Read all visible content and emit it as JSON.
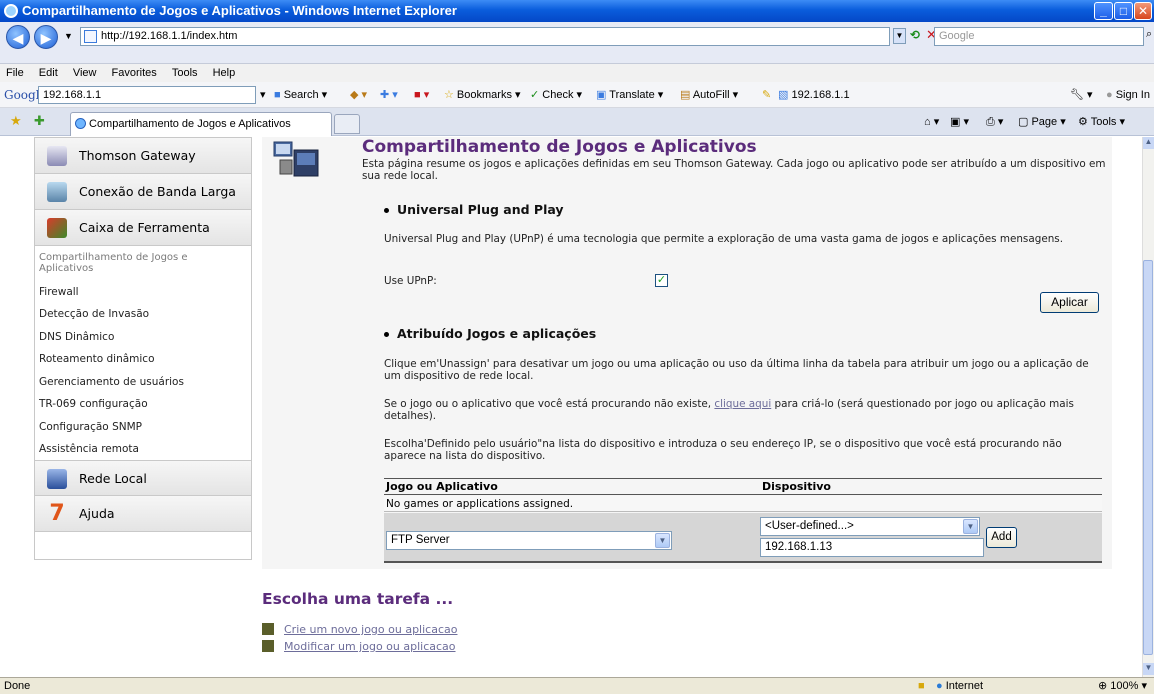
{
  "window": {
    "title": "Compartilhamento de Jogos e Aplicativos - Windows Internet Explorer"
  },
  "address": {
    "url": "http://192.168.1.1/index.htm",
    "search_placeholder": "Google"
  },
  "menu": [
    "File",
    "Edit",
    "View",
    "Favorites",
    "Tools",
    "Help"
  ],
  "google_bar": {
    "logo": "Google",
    "query": "192.168.1.1",
    "search": "Search",
    "bookmarks": "Bookmarks",
    "check": "Check",
    "translate": "Translate",
    "autofill": "AutoFill",
    "page_link": "192.168.1.1",
    "sign_in": "Sign In"
  },
  "tab": {
    "label": "Compartilhamento de Jogos e Aplicativos"
  },
  "command_bar": {
    "page": "Page",
    "tools": "Tools"
  },
  "sidebar": {
    "sections_top": [
      {
        "label": "Thomson Gateway"
      },
      {
        "label": "Conexão de Banda Larga"
      },
      {
        "label": "Caixa de Ferramenta"
      }
    ],
    "links": [
      "Compartilhamento de Jogos e Aplicativos",
      "Firewall",
      "Detecção de Invasão",
      "DNS Dinâmico",
      "Roteamento dinâmico",
      "Gerenciamento de usuários",
      "TR-069 configuração",
      "Configuração SNMP",
      "Assistência remota"
    ],
    "sections_bottom": [
      {
        "label": "Rede Local"
      },
      {
        "label": "Ajuda"
      }
    ]
  },
  "page": {
    "title": "Compartilhamento de Jogos e Aplicativos",
    "intro": "Esta página resume os jogos e aplicações definidas em seu Thomson Gateway. Cada jogo ou aplicativo pode ser atribuído a um dispositivo em sua rede local.",
    "upnp": {
      "heading": "Universal Plug and Play",
      "desc": "Universal Plug and Play (UPnP) é uma tecnologia que permite a exploração de uma vasta gama de jogos e aplicações mensagens.",
      "use_label": "Use UPnP:",
      "checked": true,
      "apply_label": "Aplicar"
    },
    "assigned": {
      "heading": "Atribuído Jogos e aplicações",
      "p1": "Clique em'Unassign' para desativar um jogo ou uma aplicação ou uso da última linha da tabela para atribuir um jogo ou a aplicação de um dispositivo de rede local.",
      "p2_before": "Se o jogo ou o aplicativo que você está procurando não existe,",
      "p2_link": "clique aqui",
      "p2_after": "para criá-lo (será questionado por jogo ou aplicação mais detalhes).",
      "p3": "Escolha'Definido pelo usuário\"na lista do dispositivo e introduza o seu endereço IP, se o dispositivo que você está procurando não aparece na lista do dispositivo.",
      "col_app": "Jogo ou Aplicativo",
      "col_device": "Dispositivo",
      "empty_row": "No games or applications assigned.",
      "app_select": "FTP Server",
      "device_select": "<User-defined...>",
      "ip_value": "192.168.1.13",
      "add_label": "Add"
    },
    "tasks": {
      "title": "Escolha uma tarefa ...",
      "items": [
        "Crie um novo jogo ou aplicacao",
        "Modificar um jogo ou aplicacao"
      ]
    }
  },
  "status": {
    "left": "Done",
    "zone": "Internet",
    "zoom": "100%"
  }
}
